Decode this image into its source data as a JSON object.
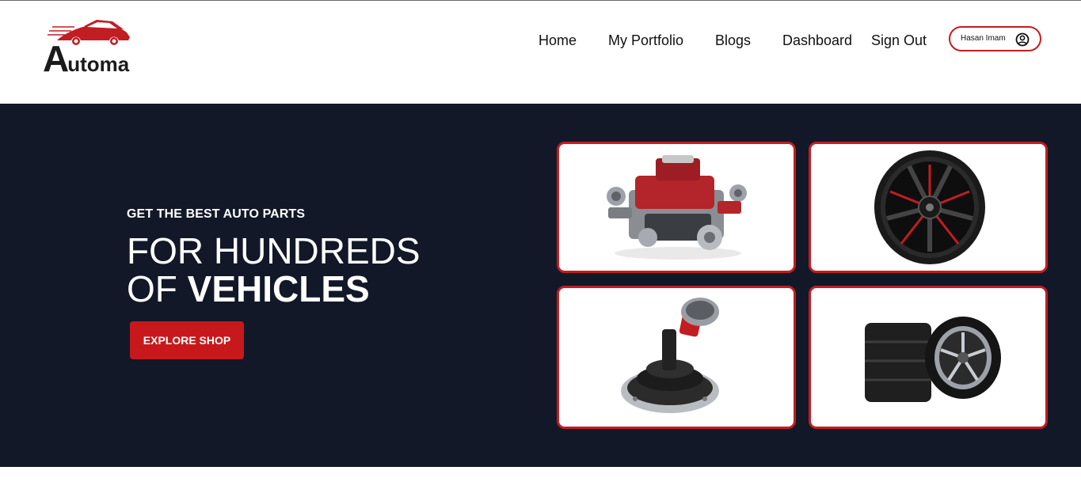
{
  "brand": {
    "name_initial": "A",
    "name_rest": "utoma"
  },
  "nav": {
    "home": "Home",
    "portfolio": "My Portfolio",
    "blogs": "Blogs",
    "dashboard": "Dashboard",
    "signout": "Sign Out"
  },
  "user": {
    "name": "Hasan Imam",
    "icon": "user-circle-icon"
  },
  "hero": {
    "kicker": "GET THE BEST AUTO PARTS",
    "line1": "FOR HUNDREDS",
    "line2_prefix": "OF ",
    "line2_bold": "VEHICLES",
    "cta": "EXPLORE SHOP"
  },
  "tiles": [
    {
      "name": "engine-image"
    },
    {
      "name": "wheel-rim-image"
    },
    {
      "name": "gear-shifter-image"
    },
    {
      "name": "tires-image"
    }
  ],
  "colors": {
    "accent": "#c21d21",
    "hero_bg": "#121828",
    "button": "#c7191c"
  }
}
